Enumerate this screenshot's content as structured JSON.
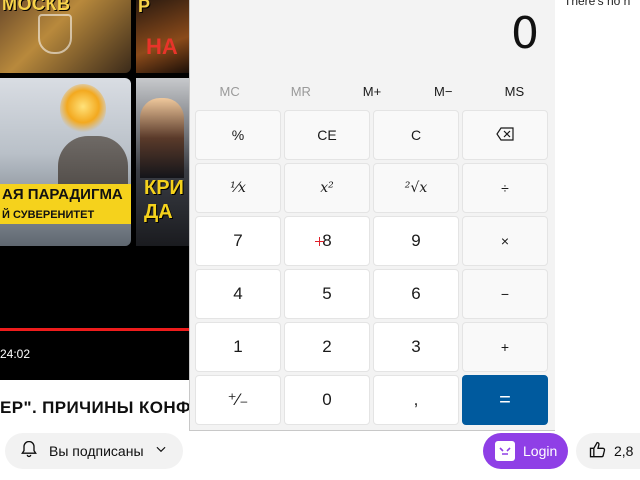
{
  "video": {
    "thumb1_text": "МОСКВ",
    "thumb2_text_top": "Р",
    "thumb2_text_bottom": "НА",
    "thumb3_banner": "АЯ ПАРАДИГМА",
    "thumb3_sub": "Й СУВЕРЕНИТЕТ",
    "thumb4_text": "КРИ\nДА",
    "timestamp": "24:02",
    "title": "ЕР\". ПРИЧИНЫ КОНФ",
    "subscribe_label": "Вы подписаны",
    "right_cut_text": "There's no h",
    "login_label": "Login",
    "like_count": "2,8"
  },
  "calculator": {
    "display": "0",
    "memory": [
      {
        "label": "MC",
        "enabled": false
      },
      {
        "label": "MR",
        "enabled": false
      },
      {
        "label": "M+",
        "enabled": true
      },
      {
        "label": "M−",
        "enabled": true
      },
      {
        "label": "MS",
        "enabled": true
      }
    ],
    "keys": {
      "percent": "%",
      "clear_entry": "CE",
      "clear": "C",
      "backspace_icon": "backspace-icon",
      "reciprocal": "¹⁄x",
      "square": "x²",
      "sqrt": "²√x",
      "divide": "÷",
      "seven": "7",
      "eight": "8",
      "nine": "9",
      "multiply": "×",
      "four": "4",
      "five": "5",
      "six": "6",
      "minus": "−",
      "one": "1",
      "two": "2",
      "three": "3",
      "plus": "+",
      "negate": "⁺⁄₋",
      "zero": "0",
      "decimal": ",",
      "equals": "="
    },
    "colors": {
      "equals_bg": "#005a9e",
      "login_bg": "#8f3fe6",
      "progress": "#ee1c1c"
    }
  }
}
